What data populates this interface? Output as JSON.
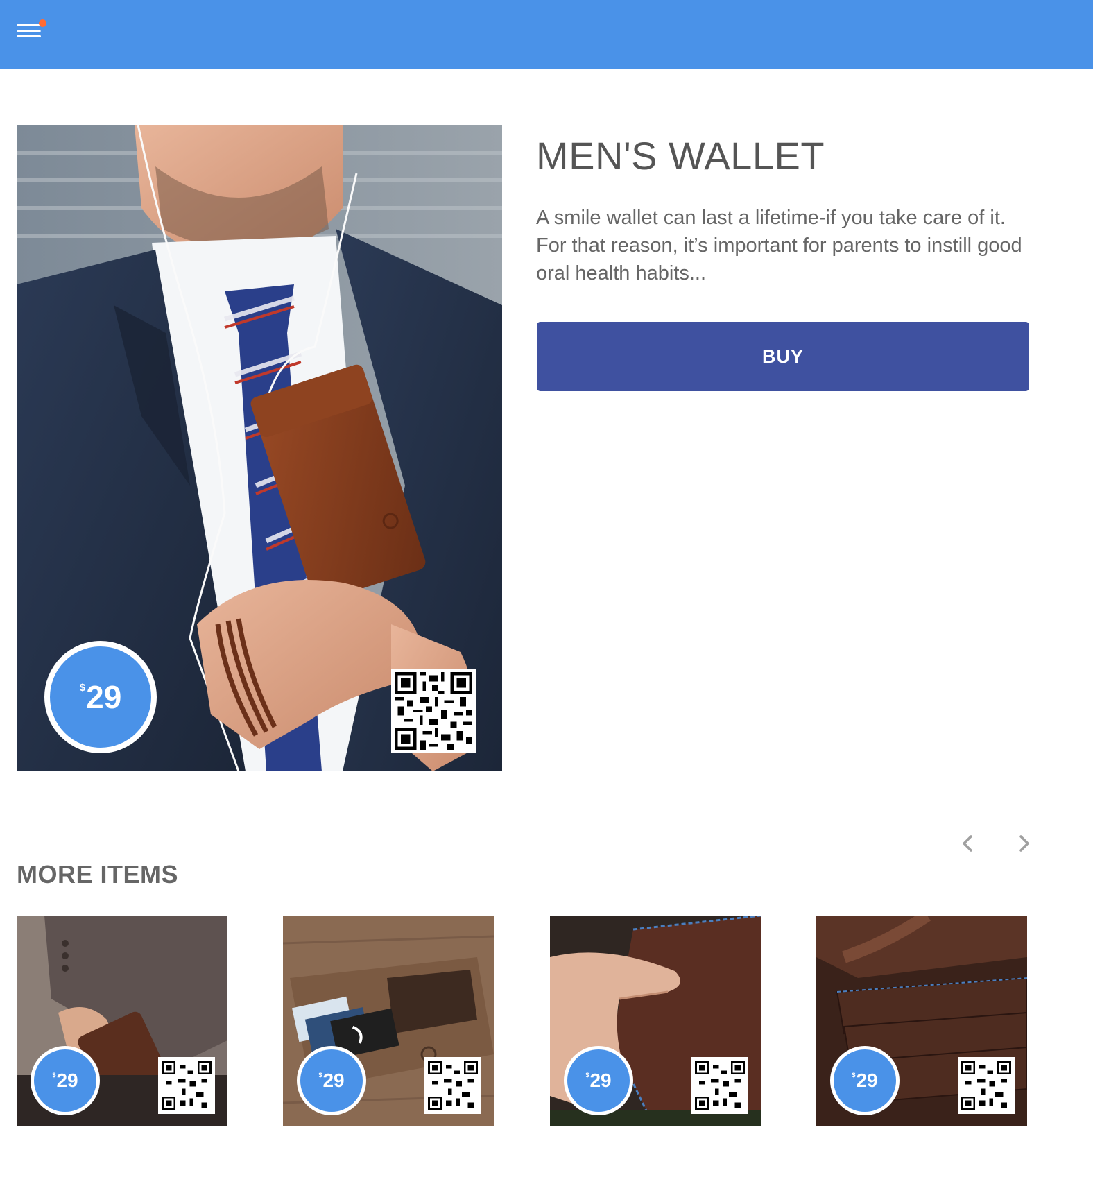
{
  "header": {
    "menu_icon": "hamburger-menu-icon",
    "notification_color": "#ff6b35",
    "background_color": "#4a92e8"
  },
  "product": {
    "title": "MEN'S WALLET",
    "description": "A smile wallet can last a lifetime-if you take care of it. For that reason, it’s important for parents to instill good oral health habits...",
    "price_currency": "$",
    "price_value": "29",
    "buy_label": "BUY",
    "buy_color": "#3f51a0"
  },
  "more_items": {
    "heading": "MORE ITEMS",
    "prev_icon": "chevron-left-icon",
    "next_icon": "chevron-right-icon",
    "items": [
      {
        "price_currency": "$",
        "price_value": "29"
      },
      {
        "price_currency": "$",
        "price_value": "29"
      },
      {
        "price_currency": "$",
        "price_value": "29"
      },
      {
        "price_currency": "$",
        "price_value": "29"
      }
    ]
  }
}
